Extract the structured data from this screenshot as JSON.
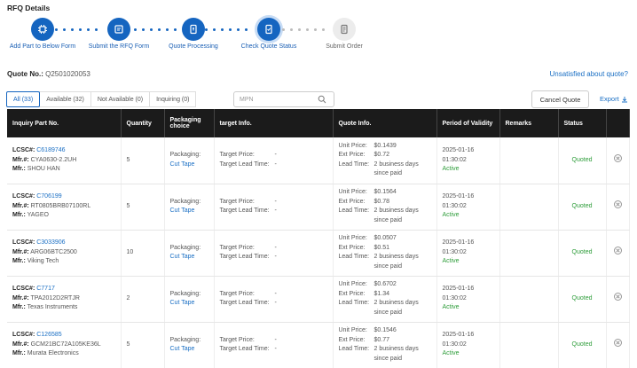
{
  "page_title": "RFQ Details",
  "steps": [
    {
      "label": "Add Part to Below Form",
      "icon": "chip-icon",
      "state": "done"
    },
    {
      "label": "Submit the RFQ Form",
      "icon": "form-icon",
      "state": "done"
    },
    {
      "label": "Quote Processing",
      "icon": "document-icon",
      "state": "done"
    },
    {
      "label": "Check Quote Status",
      "icon": "quote-status-icon",
      "state": "active"
    },
    {
      "label": "Submit Order",
      "icon": "order-icon",
      "state": "pending"
    }
  ],
  "quote": {
    "label": "Quote No.:",
    "number": "Q2501020053"
  },
  "unsatisfied_link": "Unsatisfied about quote?",
  "tabs": [
    "All (33)",
    "Available (32)",
    "Not Available (0)",
    "Inquiring (0)"
  ],
  "search": {
    "placeholder": "MPN"
  },
  "cancel_button": "Cancel Quote",
  "export_link": "Export",
  "columns": [
    "Inquiry Part No.",
    "Quantity",
    "Packaging choice",
    "target Info.",
    "Quote Info.",
    "Period of Validity",
    "Remarks",
    "Status"
  ],
  "labels": {
    "lcsc": "LCSC#:",
    "mfr_no": "Mfr.#:",
    "mfr": "Mfr.:",
    "packaging": "Packaging:",
    "target_price": "Target Price:",
    "target_lead": "Target Lead Time:",
    "unit_price": "Unit Price:",
    "ext_price": "Ext Price:",
    "lead_time": "Lead Time:"
  },
  "rows": [
    {
      "lcsc": "C6189746",
      "mfr_no": "CYA0630-2.2UH",
      "mfr": "SHOU HAN",
      "qty": "5",
      "packaging": "Cut Tape",
      "target_price": "-",
      "target_lead": "-",
      "unit_price": "$0.1439",
      "ext_price": "$0.72",
      "lead_time_1": "2 business days",
      "lead_time_2": "since paid",
      "validity_date": "2025-01-16",
      "validity_time": "01:30:02",
      "validity_status": "Active",
      "status": "Quoted"
    },
    {
      "lcsc": "C706199",
      "mfr_no": "RT0805BRB07100RL",
      "mfr": "YAGEO",
      "qty": "5",
      "packaging": "Cut Tape",
      "target_price": "-",
      "target_lead": "-",
      "unit_price": "$0.1564",
      "ext_price": "$0.78",
      "lead_time_1": "2 business days",
      "lead_time_2": "since paid",
      "validity_date": "2025-01-16",
      "validity_time": "01:30:02",
      "validity_status": "Active",
      "status": "Quoted"
    },
    {
      "lcsc": "C3033906",
      "mfr_no": "ARG06BTC2500",
      "mfr": "Viking Tech",
      "qty": "10",
      "packaging": "Cut Tape",
      "target_price": "-",
      "target_lead": "-",
      "unit_price": "$0.0507",
      "ext_price": "$0.51",
      "lead_time_1": "2 business days",
      "lead_time_2": "since paid",
      "validity_date": "2025-01-16",
      "validity_time": "01:30:02",
      "validity_status": "Active",
      "status": "Quoted"
    },
    {
      "lcsc": "C7717",
      "mfr_no": "TPA2012D2RTJR",
      "mfr": "Texas Instruments",
      "qty": "2",
      "packaging": "Cut Tape",
      "target_price": "-",
      "target_lead": "-",
      "unit_price": "$0.6702",
      "ext_price": "$1.34",
      "lead_time_1": "2 business days",
      "lead_time_2": "since paid",
      "validity_date": "2025-01-16",
      "validity_time": "01:30:02",
      "validity_status": "Active",
      "status": "Quoted"
    },
    {
      "lcsc": "C126585",
      "mfr_no": "GCM21BC72A105KE36L",
      "mfr": "Murata Electronics",
      "qty": "5",
      "packaging": "Cut Tape",
      "target_price": "-",
      "target_lead": "-",
      "unit_price": "$0.1546",
      "ext_price": "$0.77",
      "lead_time_1": "2 business days",
      "lead_time_2": "since paid",
      "validity_date": "2025-01-16",
      "validity_time": "01:30:02",
      "validity_status": "Active",
      "status": "Quoted"
    }
  ]
}
